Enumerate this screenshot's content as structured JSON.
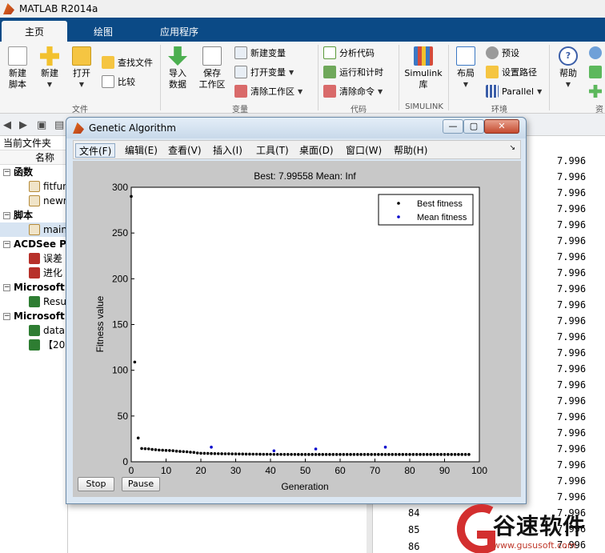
{
  "app": {
    "title": "MATLAB R2014a"
  },
  "tabs": [
    {
      "label": "主页",
      "active": true
    },
    {
      "label": "绘图",
      "active": false
    },
    {
      "label": "应用程序",
      "active": false
    }
  ],
  "ribbon": {
    "new_script": "新建\n脚本",
    "new": "新建",
    "open": "打开",
    "find_files": "查找文件",
    "compare": "比较",
    "group_file": "文件",
    "import_data": "导入\n数据",
    "save_workspace": "保存\n工作区",
    "new_variable": "新建变量",
    "open_variable": "打开变量",
    "clear_workspace": "清除工作区",
    "group_variable": "变量",
    "analyze_code": "分析代码",
    "run_and_time": "运行和计时",
    "clear_commands": "清除命令",
    "group_code": "代码",
    "simulink": "Simulink\n库",
    "group_simulink": "SIMULINK",
    "layout": "布局",
    "preferences": "预设",
    "set_path": "设置路径",
    "parallel": "Parallel",
    "group_env": "环境",
    "help": "帮助",
    "group_resources": "资"
  },
  "file_panel": {
    "title": "当前文件夹",
    "col_name": "名称",
    "groups": [
      {
        "label": "函数",
        "items": [
          "fitfun",
          "newr"
        ]
      },
      {
        "label": "脚本",
        "items": [
          "main"
        ]
      },
      {
        "label": "ACDSee PN",
        "items": [
          "误差",
          "进化"
        ]
      },
      {
        "label": "Microsoft",
        "items": [
          "Resu"
        ]
      },
      {
        "label": "Microsoft",
        "items": [
          "data",
          "【20"
        ]
      }
    ]
  },
  "workspace_values": [
    "7.996",
    "7.996",
    "7.996",
    "7.996",
    "7.996",
    "7.996",
    "7.996",
    "7.996",
    "7.996",
    "7.996",
    "7.996",
    "7.996",
    "7.996",
    "7.996",
    "7.996",
    "7.996",
    "7.996",
    "7.996",
    "7.996",
    "7.996",
    "7.996",
    "7.996",
    "7.996",
    "7.996",
    "7.996",
    "7.996"
  ],
  "lower_rows": [
    {
      "idx": "84",
      "val": "7.996"
    },
    {
      "idx": "85",
      "val": "7.996"
    },
    {
      "idx": "86",
      "val": "7.996"
    }
  ],
  "ga_window": {
    "title": "Genetic Algorithm",
    "menus": [
      "文件(F)",
      "编辑(E)",
      "查看(V)",
      "插入(I)",
      "工具(T)",
      "桌面(D)",
      "窗口(W)",
      "帮助(H)"
    ],
    "stop_button": "Stop",
    "pause_button": "Pause"
  },
  "chart_data": {
    "type": "scatter",
    "title": "Best: 7.99558 Mean: Inf",
    "xlabel": "Generation",
    "ylabel": "Fitness value",
    "xlim": [
      0,
      100
    ],
    "ylim": [
      0,
      300
    ],
    "xticks": [
      0,
      10,
      20,
      30,
      40,
      50,
      60,
      70,
      80,
      90,
      100
    ],
    "yticks": [
      0,
      50,
      100,
      150,
      200,
      250,
      300
    ],
    "legend_position": "top-right",
    "series": [
      {
        "name": "Best fitness",
        "color": "#000000",
        "x": [
          0,
          1,
          2,
          3,
          4,
          5,
          6,
          7,
          8,
          9,
          10,
          11,
          12,
          13,
          14,
          15,
          16,
          17,
          18,
          19,
          20,
          21,
          22,
          23,
          24,
          25,
          26,
          27,
          28,
          29,
          30,
          31,
          32,
          33,
          34,
          35,
          36,
          37,
          38,
          39,
          40,
          41,
          42,
          43,
          44,
          45,
          46,
          47,
          48,
          49,
          50,
          51,
          52,
          53,
          54,
          55,
          56,
          57,
          58,
          59,
          60,
          61,
          62,
          63,
          64,
          65,
          66,
          67,
          68,
          69,
          70,
          71,
          72,
          73,
          74,
          75,
          76,
          77,
          78,
          79,
          80,
          81,
          82,
          83,
          84,
          85,
          86,
          87,
          88,
          89,
          90,
          91,
          92,
          93,
          94,
          95,
          96,
          97
        ],
        "y": [
          290,
          109,
          26,
          14.5,
          14.3,
          14.1,
          13.5,
          13.2,
          12.8,
          12.6,
          12.4,
          12.3,
          12.1,
          11.6,
          11.3,
          11.1,
          10.9,
          10.5,
          10.2,
          9.6,
          9.3,
          9.2,
          9.1,
          9.0,
          8.9,
          8.85,
          8.8,
          8.75,
          8.7,
          8.6,
          8.55,
          8.5,
          8.45,
          8.4,
          8.35,
          8.3,
          8.3,
          8.25,
          8.2,
          8.2,
          8.15,
          8.1,
          8.1,
          8.1,
          8.05,
          8.05,
          8.05,
          8.05,
          8.0,
          8.0,
          8.0,
          8.0,
          8.0,
          8.0,
          8.0,
          8.0,
          8.0,
          8.0,
          8.0,
          8.0,
          8.0,
          8.0,
          8.0,
          8.0,
          8.0,
          8.0,
          8.0,
          8.0,
          8.0,
          8.0,
          8.0,
          8.0,
          8.0,
          8.0,
          8.0,
          8.0,
          8.0,
          8.0,
          8.0,
          8.0,
          8.0,
          8.0,
          8.0,
          8.0,
          8.0,
          8.0,
          8.0,
          8.0,
          8.0,
          8.0,
          8.0,
          8.0,
          8.0,
          8.0,
          8.0,
          8.0,
          8.0,
          8.0
        ]
      },
      {
        "name": "Mean fitness",
        "color": "#0000cc",
        "x": [
          23,
          41,
          53,
          73
        ],
        "y": [
          16,
          12,
          14,
          16
        ]
      }
    ]
  },
  "watermark": {
    "text": "谷速软件",
    "url": "www.gususoft.com"
  }
}
